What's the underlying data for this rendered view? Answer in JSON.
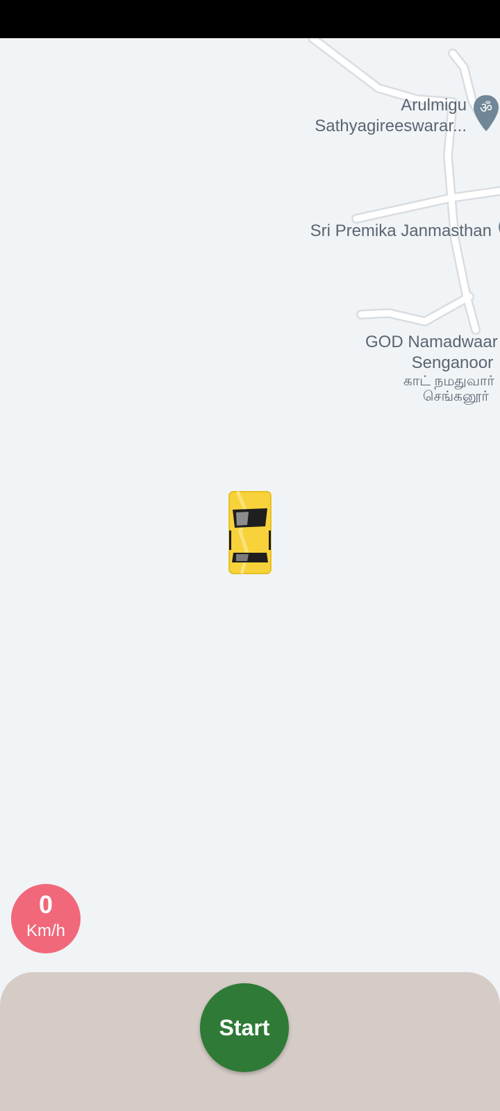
{
  "map": {
    "places": [
      {
        "line1": "Arulmigu",
        "line2": "Sathyagireeswarar..."
      },
      {
        "line1": "Sri Premika Janmasthan"
      },
      {
        "line1": "GOD Namadwaar",
        "line2": "Senganoor",
        "line3": "காட் நமதுவார்",
        "line4": "செங்கனூர்"
      }
    ],
    "pin_icons": [
      "om-temple-pin-icon",
      "place-pin-icon"
    ],
    "background_color": "#f1f4f6",
    "road_color": "#ffffff"
  },
  "vehicle": {
    "icon": "yellow-car-icon",
    "color": "#f7d23a"
  },
  "speedometer": {
    "value": "0",
    "unit": "Km/h",
    "color": "#f0687a"
  },
  "controls": {
    "start_label": "Start",
    "start_color": "#2e7a36",
    "sheet_color": "#d6ccc7"
  }
}
